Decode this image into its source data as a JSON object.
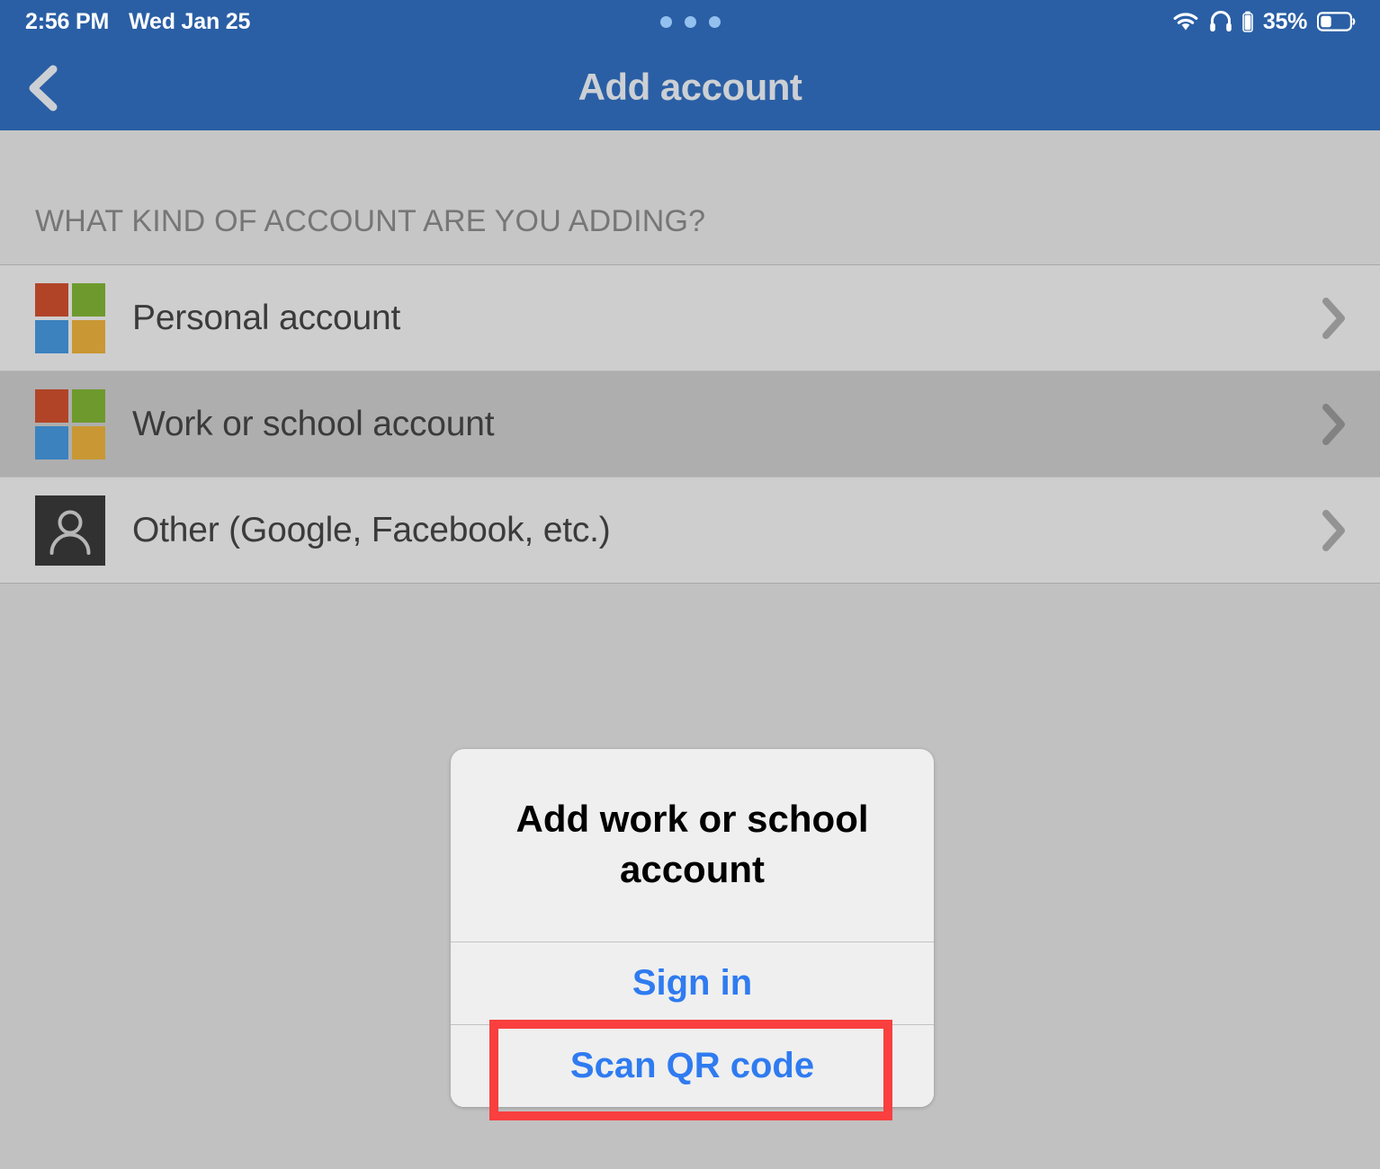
{
  "status_bar": {
    "time": "2:56 PM",
    "date": "Wed Jan 25",
    "battery_percent": "35%",
    "wifi_icon": "wifi-icon",
    "headphones_icon": "headphones-icon",
    "battery_icon": "battery-icon",
    "multitask_dots_icon": "multitask-dots-icon",
    "background_color": "#2a5fa5",
    "text_color": "#ffffff"
  },
  "nav_bar": {
    "back_icon": "chevron-left-icon",
    "title": "Add account",
    "background_color": "#2a5fa5",
    "title_color": "#ccd0d4"
  },
  "section": {
    "header": "WHAT KIND OF ACCOUNT ARE YOU ADDING?",
    "header_color": "#767676"
  },
  "account_rows": [
    {
      "label": "Personal account",
      "icon": "microsoft-logo-icon",
      "chevron": "chevron-right-icon",
      "selected": false
    },
    {
      "label": "Work or school account",
      "icon": "microsoft-logo-icon",
      "chevron": "chevron-right-icon",
      "selected": true
    },
    {
      "label": "Other (Google, Facebook, etc.)",
      "icon": "person-icon",
      "chevron": "chevron-right-icon",
      "selected": false
    }
  ],
  "microsoft_logo_colors": {
    "top_left": "#b14427",
    "top_right": "#6e9a2d",
    "bottom_left": "#3b82bf",
    "bottom_right": "#c99733"
  },
  "alert": {
    "title": "Add work or school account",
    "actions": [
      {
        "label": "Sign in"
      },
      {
        "label": "Scan QR code"
      }
    ],
    "action_color": "#2f7bf0",
    "background_color": "#efefef"
  },
  "annotation": {
    "target": "Scan QR code",
    "color": "#f93f3f"
  },
  "colors": {
    "page_background": "#c1c1c1",
    "list_row": "#cecece",
    "list_row_selected": "#aeaeae",
    "section_background": "#c6c6c6"
  }
}
